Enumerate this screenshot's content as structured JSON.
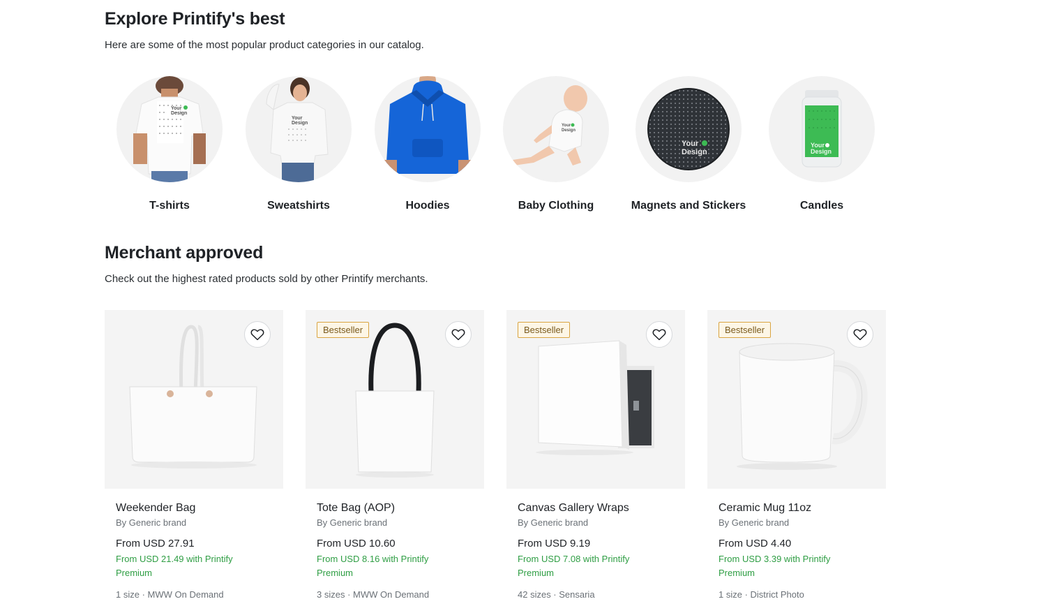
{
  "explore": {
    "title": "Explore Printify's best",
    "subtitle": "Here are some of the most popular product categories in our catalog.",
    "categories": [
      {
        "label": "T-shirts",
        "icon": "tshirt-model-image"
      },
      {
        "label": "Sweatshirts",
        "icon": "sweatshirt-model-image"
      },
      {
        "label": "Hoodies",
        "icon": "hoodie-model-image"
      },
      {
        "label": "Baby Clothing",
        "icon": "baby-bodysuit-image"
      },
      {
        "label": "Magnets and Stickers",
        "icon": "round-magnet-image"
      },
      {
        "label": "Candles",
        "icon": "candle-jar-image"
      }
    ],
    "design_mark": "Your Design"
  },
  "merchant": {
    "title": "Merchant approved",
    "subtitle": "Check out the highest rated products sold by other Printify merchants.",
    "products": [
      {
        "name": "Weekender Bag",
        "brand": "By Generic brand",
        "price": "From USD 27.91",
        "premium": "From USD 21.49 with Printify Premium",
        "meta": "1 size · MWW On Demand",
        "badge": ""
      },
      {
        "name": "Tote Bag (AOP)",
        "brand": "By Generic brand",
        "price": "From USD 10.60",
        "premium": "From USD 8.16 with Printify Premium",
        "meta": "3 sizes · MWW On Demand",
        "badge": "Bestseller"
      },
      {
        "name": "Canvas Gallery Wraps",
        "brand": "By Generic brand",
        "price": "From USD 9.19",
        "premium": "From USD 7.08 with Printify Premium",
        "meta": "42 sizes · Sensaria",
        "badge": "Bestseller"
      },
      {
        "name": "Ceramic Mug 11oz",
        "brand": "By Generic brand",
        "price": "From USD 4.40",
        "premium": "From USD 3.39 with Printify Premium",
        "meta": "1 size · District Photo",
        "badge": "Bestseller"
      }
    ]
  },
  "colors": {
    "premium_green": "#2f9e44",
    "badge_border": "#d9a441",
    "hoodie_blue": "#1565d8",
    "candle_green": "#3dbb54"
  }
}
